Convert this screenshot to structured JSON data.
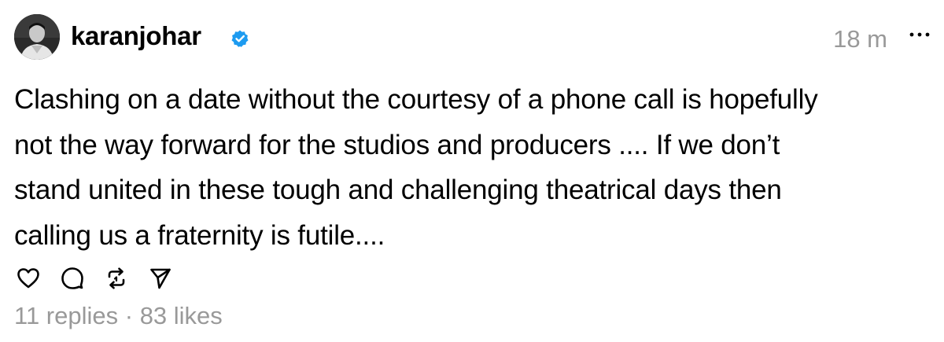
{
  "post": {
    "author": {
      "username": "karanjohar",
      "verified": true,
      "avatar_icon": "profile-photo"
    },
    "timestamp": "18 m",
    "more_icon": "ellipsis-icon",
    "text": "Clashing on a date without the courtesy of a phone call is hopefully\nnot the way forward for the studios and producers .... If we don’t\nstand united in these tough and challenging theatrical days then\ncalling us a fraternity is futile....",
    "actions": [
      {
        "name": "like",
        "icon": "heart-icon"
      },
      {
        "name": "reply",
        "icon": "comment-icon"
      },
      {
        "name": "repost",
        "icon": "repost-icon"
      },
      {
        "name": "share",
        "icon": "send-icon"
      }
    ],
    "stats": {
      "replies": "11 replies",
      "separator": " · ",
      "likes": "83 likes"
    }
  },
  "colors": {
    "text": "#000000",
    "muted": "#999999",
    "verified_badge": "#1d9bf0",
    "background": "#ffffff"
  }
}
